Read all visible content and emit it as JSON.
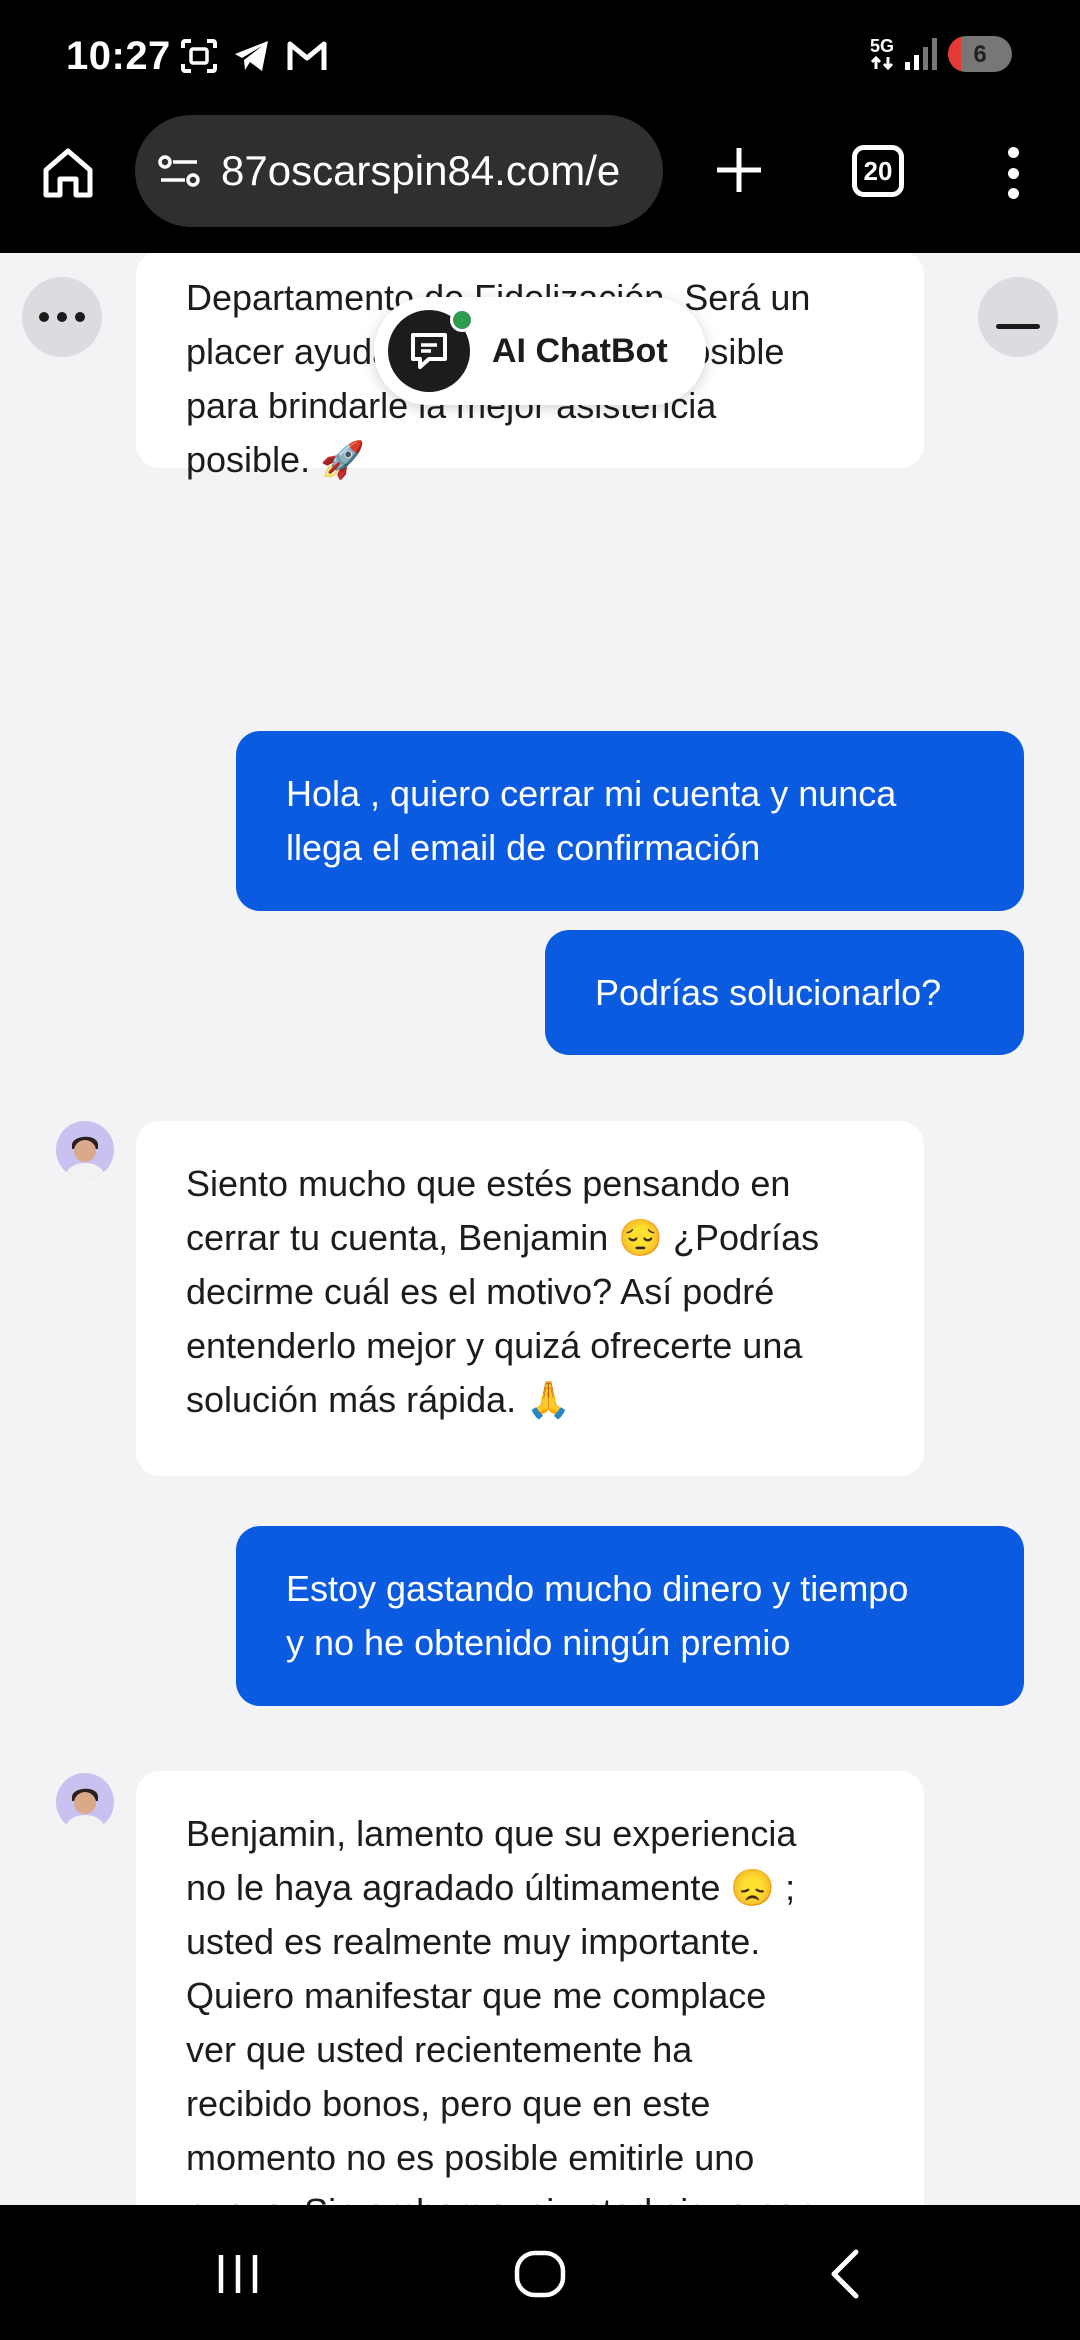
{
  "status_bar": {
    "time": "10:27",
    "network": "5G",
    "battery": "6",
    "battery_level": 0.06,
    "left_icons": [
      "screenshot-icon",
      "telegram-icon",
      "gmail-icon"
    ],
    "right_icons": [
      "signal-icon",
      "battery-icon"
    ]
  },
  "browser": {
    "url": "87oscarspin84.com/e",
    "tab_count": "20",
    "icons": [
      "home-icon",
      "site-settings-icon",
      "plus-icon",
      "tab-switcher-icon",
      "more-vert-icon"
    ]
  },
  "chat": {
    "header": {
      "title": "AI ChatBot",
      "status_color": "#2e9b4f",
      "options_icon": "more-horiz-icon",
      "minimize_icon": "minimize-icon"
    },
    "messages": [
      {
        "sender": "bot",
        "text": "Departamento de Fidelización. Será un\nplacer ayudarle y haré todo lo posible\npara brindarle la mejor asistencia\nposible. 🚀"
      },
      {
        "sender": "user",
        "text": "Hola , quiero cerrar mi cuenta y nunca\nllega el email de confirmación"
      },
      {
        "sender": "user",
        "text": "Podrías solucionarlo?"
      },
      {
        "sender": "bot",
        "text": "Siento mucho que estés pensando en\ncerrar tu cuenta, Benjamin 😔 ¿Podrías\ndecirme cuál es el motivo? Así podré\nentenderlo mejor y quizá ofrecerte una\nsolución más rápida. 🙏"
      },
      {
        "sender": "user",
        "text": "Estoy gastando mucho dinero y tiempo\ny no he obtenido ningún premio"
      },
      {
        "sender": "bot",
        "text": "Benjamin, lamento que su experiencia\nno le haya agradado últimamente 😞 ;\nusted es realmente muy importante.\nQuiero manifestar que me complace\nver que usted recientemente ha\nrecibido bonos, pero que en este\nmomento no es posible emitirle uno\nnuevo. Sin embargo, si usted sigue con"
      }
    ],
    "colors": {
      "user_bubble": "#0b5be0",
      "bot_bubble": "#ffffff",
      "background": "#f3f3f5"
    }
  },
  "nav_bar": {
    "icons": [
      "recents-icon",
      "home-circle-icon",
      "back-icon"
    ]
  }
}
